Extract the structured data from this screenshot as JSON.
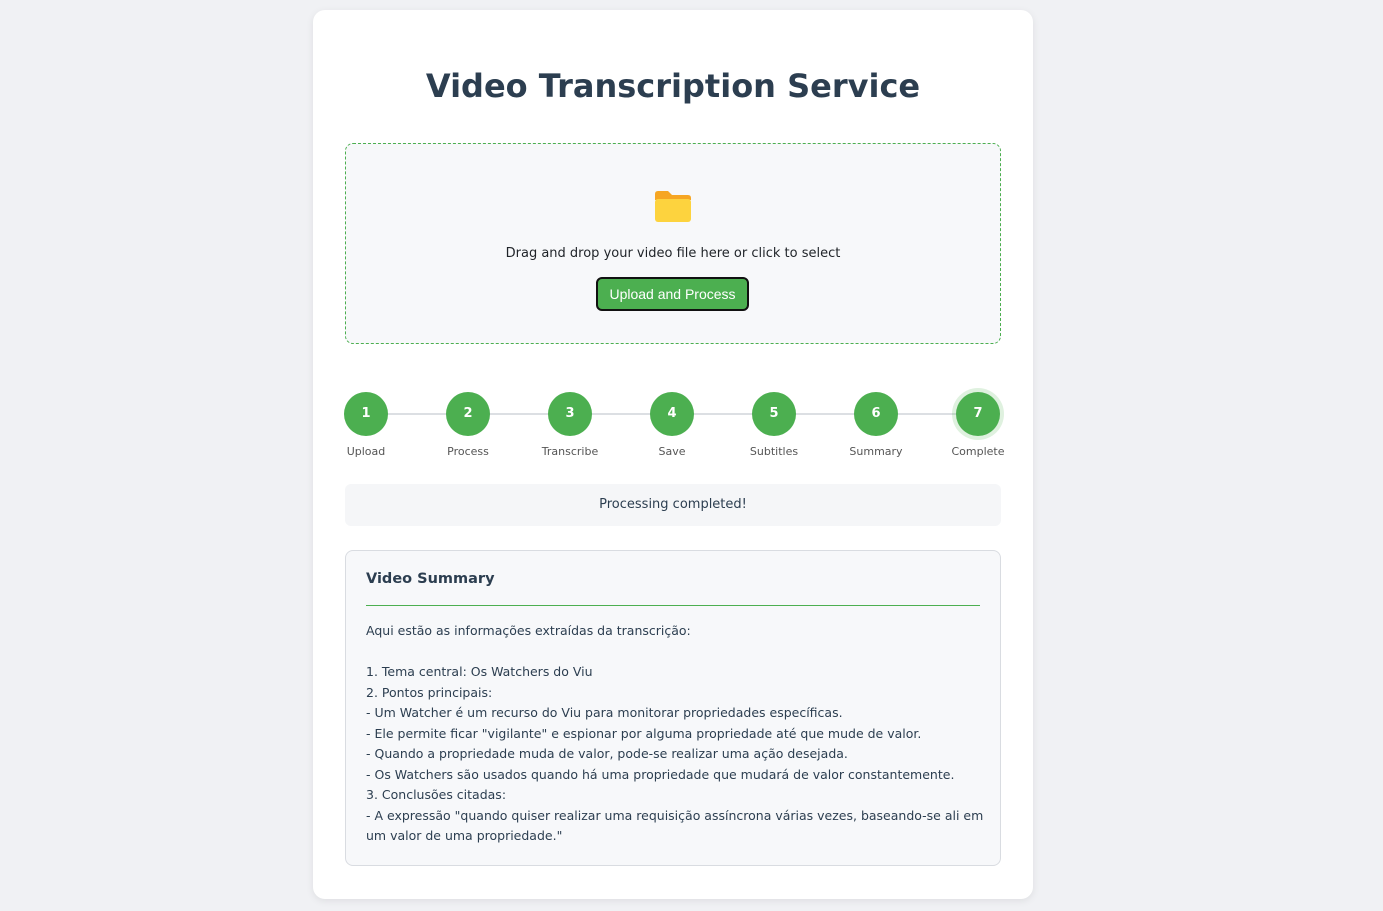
{
  "page": {
    "title": "Video Transcription Service"
  },
  "upload": {
    "icon": "folder-icon",
    "drop_text": "Drag and drop your video file here or click to select",
    "button_label": "Upload and Process"
  },
  "steps": [
    {
      "number": "1",
      "label": "Upload"
    },
    {
      "number": "2",
      "label": "Process"
    },
    {
      "number": "3",
      "label": "Transcribe"
    },
    {
      "number": "4",
      "label": "Save"
    },
    {
      "number": "5",
      "label": "Subtitles"
    },
    {
      "number": "6",
      "label": "Summary"
    },
    {
      "number": "7",
      "label": "Complete"
    }
  ],
  "status": {
    "text": "Processing completed!"
  },
  "summary": {
    "title": "Video Summary",
    "body": "Aqui estão as informações extraídas da transcrição:\n\n1. Tema central: Os Watchers do Viu\n2. Pontos principais:\n- Um Watcher é um recurso do Viu para monitorar propriedades específicas.\n- Ele permite ficar \"vigilante\" e espionar por alguma propriedade até que mude de valor.\n- Quando a propriedade muda de valor, pode-se realizar uma ação desejada.\n- Os Watchers são usados quando há uma propriedade que mudará de valor constantemente.\n3. Conclusões citadas:\n- A expressão \"quando quiser realizar uma requisição assíncrona várias vezes, baseando-se ali em um valor de uma propriedade.\""
  },
  "colors": {
    "accent": "#4caf50",
    "title": "#2c3e50",
    "background": "#f0f1f4"
  }
}
